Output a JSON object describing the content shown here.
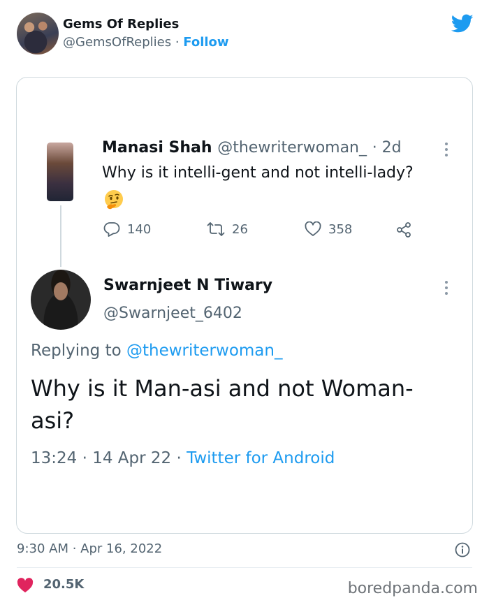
{
  "outer": {
    "name": "Gems Of Replies",
    "handle": "@GemsOfReplies",
    "separator": " · ",
    "follow_label": "Follow",
    "timestamp": "9:30 AM · Apr 16, 2022",
    "likes": "20.5K"
  },
  "quoted": {
    "name": "Manasi Shah",
    "handle": "@thewriterwoman_",
    "age": "· 2d",
    "text": "Why is it intelli-gent and not intelli-lady?",
    "emoji": "thinking-face",
    "replies": "140",
    "retweets": "26",
    "likes": "358"
  },
  "reply": {
    "name": "Swarnjeet N Tiwary",
    "handle": "@Swarnjeet_6402",
    "replying_prefix": "Replying to ",
    "replying_to": "@thewriterwoman_",
    "text": "Why is it Man-asi and not Woman-asi?",
    "time_date": "13:24 · 14 Apr 22 · ",
    "source": "Twitter for Android"
  },
  "watermark": "boredpanda.com",
  "colors": {
    "accent": "#1d9bf0",
    "muted": "#536471",
    "heart": "#e0245e"
  }
}
